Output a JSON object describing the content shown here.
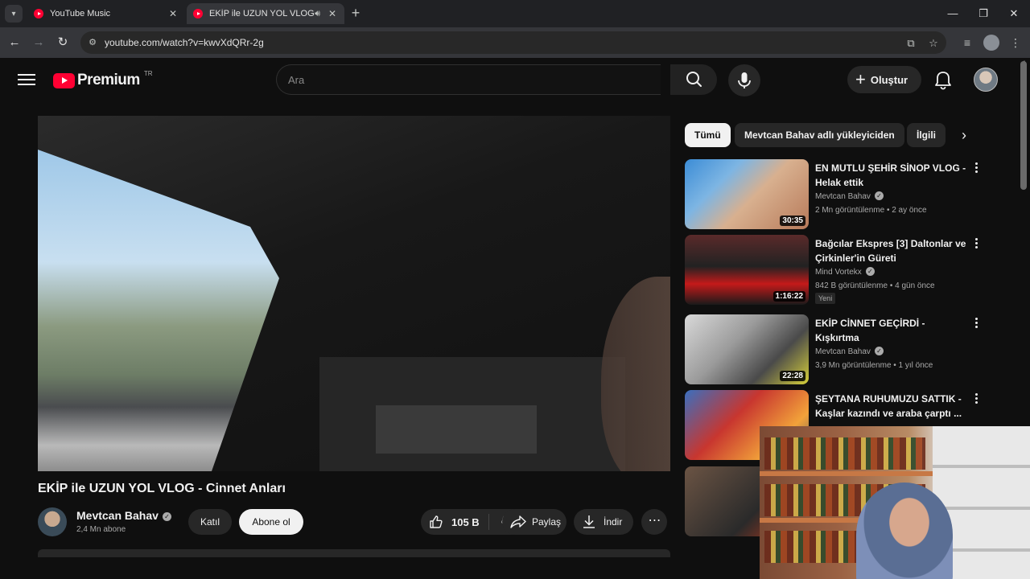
{
  "browser": {
    "tabs": [
      {
        "title": "YouTube Music",
        "active": false
      },
      {
        "title": "EKİP ile UZUN YOL VLOG -",
        "active": true
      }
    ],
    "url": "youtube.com/watch?v=kwvXdQRr-2g"
  },
  "header": {
    "logo_text": "Premium",
    "country_code": "TR",
    "search_placeholder": "Ara",
    "create_label": "Oluştur"
  },
  "video": {
    "title": "EKİP ile UZUN YOL VLOG - Cinnet Anları",
    "channel": "Mevtcan Bahav",
    "subscribers": "2,4 Mn abone",
    "join_label": "Katıl",
    "subscribe_label": "Abone ol",
    "likes": "105 B",
    "share_label": "Paylaş",
    "download_label": "İndir"
  },
  "chips": [
    "Tümü",
    "Mevtcan Bahav adlı yükleyiciden",
    "İlgili"
  ],
  "recommendations": [
    {
      "title": "EN MUTLU ŞEHİR SİNOP VLOG - Helak ettik",
      "channel": "Mevtcan Bahav",
      "meta": "2 Mn görüntülenme • 2 ay önce",
      "duration": "30:35",
      "badge": ""
    },
    {
      "title": "Bağcılar Ekspres [3] Daltonlar ve Çirkinler'in Güreti",
      "channel": "Mind Vortekx",
      "meta": "842 B görüntülenme • 4 gün önce",
      "duration": "1:16:22",
      "badge": "Yeni"
    },
    {
      "title": "EKİP CİNNET GEÇİRDİ - Kışkırtma",
      "channel": "Mevtcan Bahav",
      "meta": "3,9 Mn görüntülenme • 1 yıl önce",
      "duration": "22:28",
      "badge": ""
    },
    {
      "title": "ŞEYTANA RUHUMUZU SATTIK - Kaşlar kazındı ve araba çarptı ...",
      "channel": "",
      "meta": "",
      "duration": "",
      "badge": ""
    }
  ],
  "colors": {
    "brand_red": "#ff0033",
    "background": "#0f0f0f",
    "chip_bg": "#272727"
  }
}
